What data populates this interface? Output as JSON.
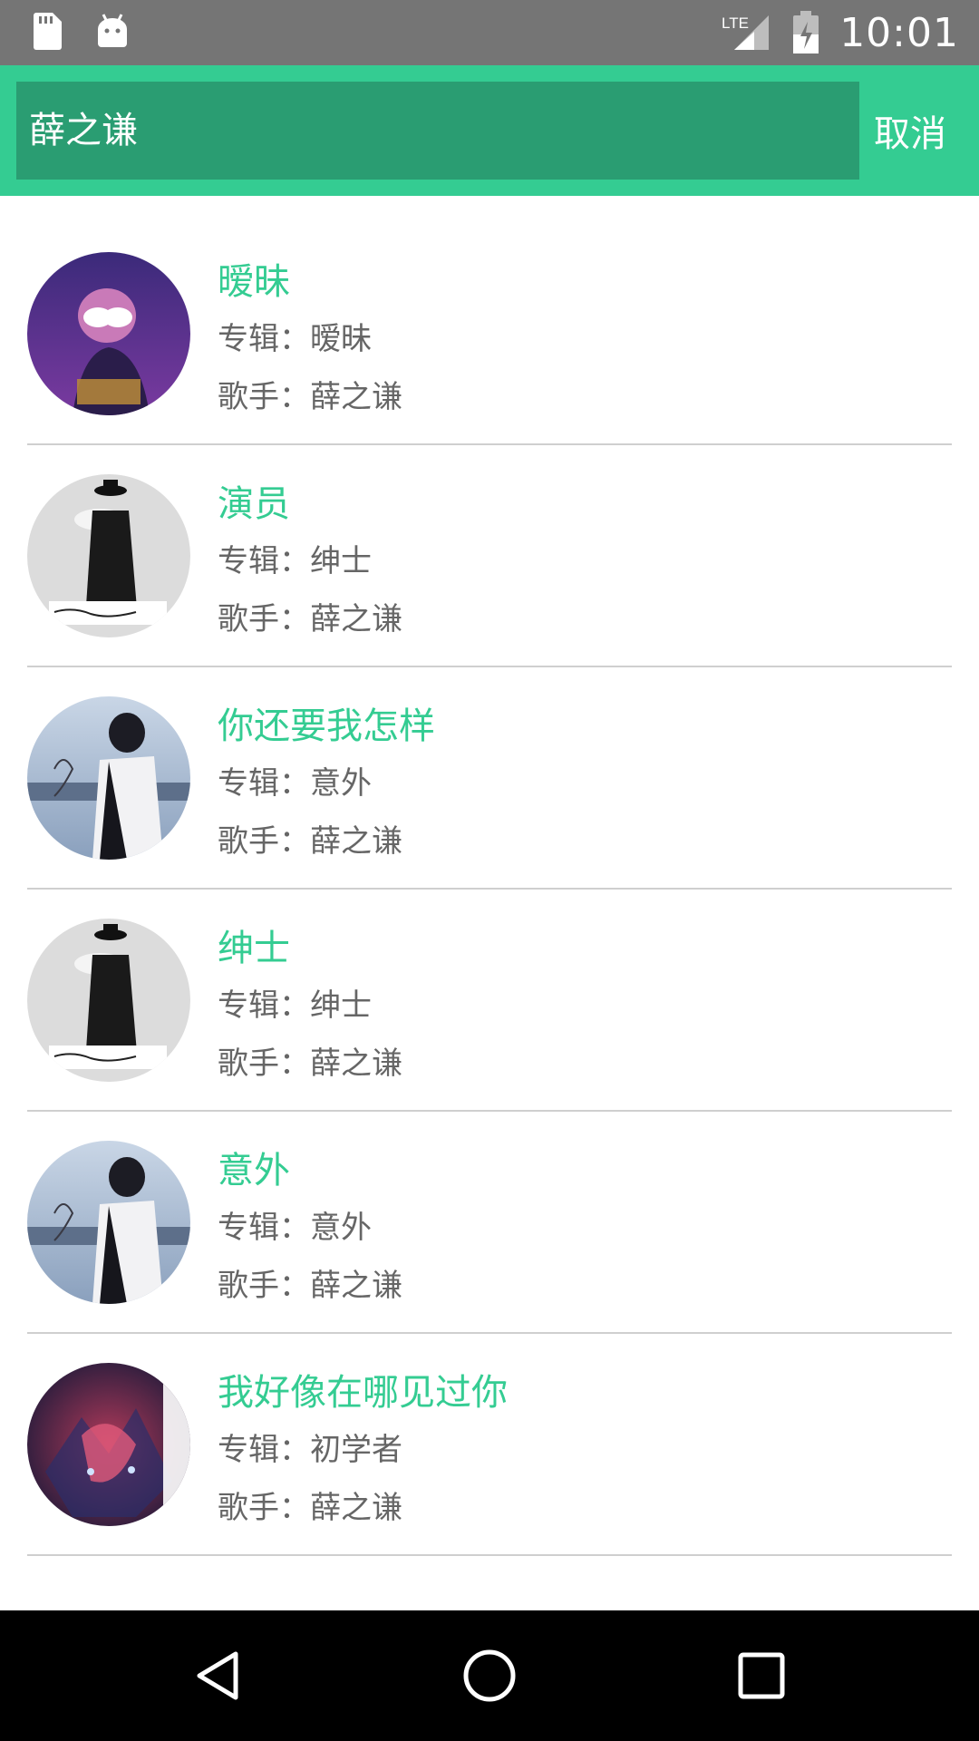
{
  "status_bar": {
    "time": "10:01",
    "network": "LTE",
    "icons": [
      "sd-card-icon",
      "android-icon",
      "signal-icon",
      "battery-charging-icon"
    ]
  },
  "search": {
    "query": "薛之谦",
    "cancel_label": "取消"
  },
  "colors": {
    "accent": "#34cc92",
    "search_box": "#2a9d72",
    "meta_text": "#666666",
    "divider": "#cfcfcf"
  },
  "results": [
    {
      "title": "暧昧",
      "album": "专辑：暧昧",
      "singer": "歌手：薛之谦",
      "cover": "album-cover-aimei"
    },
    {
      "title": "演员",
      "album": "专辑：绅士",
      "singer": "歌手：薛之谦",
      "cover": "album-cover-shenshi"
    },
    {
      "title": "你还要我怎样",
      "album": "专辑：意外",
      "singer": "歌手：薛之谦",
      "cover": "album-cover-yiwai"
    },
    {
      "title": "绅士",
      "album": "专辑：绅士",
      "singer": "歌手：薛之谦",
      "cover": "album-cover-shenshi"
    },
    {
      "title": "意外",
      "album": "专辑：意外",
      "singer": "歌手：薛之谦",
      "cover": "album-cover-yiwai"
    },
    {
      "title": "我好像在哪见过你",
      "album": "专辑：初学者",
      "singer": "歌手：薛之谦",
      "cover": "album-cover-chuxuezhe"
    }
  ],
  "nav": {
    "icons": [
      "back-icon",
      "home-icon",
      "recents-icon"
    ]
  }
}
